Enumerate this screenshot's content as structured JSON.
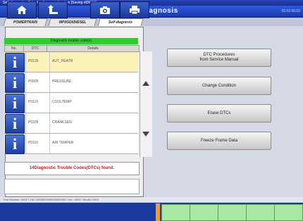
{
  "window": {
    "title": "Self-diagnosis - Select a diagnosis function [Saving diDEFC]"
  },
  "header": {
    "title": "Self-diagnosis",
    "version": "02.02.00.02"
  },
  "tabs": [
    {
      "label": "POWERTRAIN"
    },
    {
      "label": "MPI/GDI/DIESEL"
    },
    {
      "label": "Self-diagnosis"
    }
  ],
  "dtc_list": {
    "header": "Diagnostic trouble code(s)",
    "columns": [
      "No.",
      "DTC",
      "Details"
    ],
    "rows": [
      {
        "code": "P0135",
        "term": "AUT_HEATR"
      },
      {
        "code": "P0505",
        "term": "PRESSURE"
      },
      {
        "code": "P0115",
        "term": "COOLTEMP"
      },
      {
        "code": "P0335",
        "term": "CRANKSEN"
      },
      {
        "code": "P0110",
        "term": "AIR TEMPER"
      }
    ],
    "status": "14Diagnostic Trouble Codes(DTCs) found."
  },
  "actions": [
    {
      "label": "DTC Procedures\nfrom Service Manual"
    },
    {
      "label": "Change Condition"
    },
    {
      "label": "Erase DTCs"
    },
    {
      "label": "Freeze Frame Data"
    }
  ],
  "footer": {
    "text": "Part Number: 0000 / VIN: 0000000000000000000 / Ver.: 0000 / Model: 0000"
  },
  "toolbar": {
    "buttons": [
      {
        "icon": "home-icon"
      },
      {
        "icon": "back-icon"
      },
      {
        "icon": "camera-icon"
      },
      {
        "icon": "print-icon"
      }
    ]
  },
  "colors": {
    "accent": "#2ecc2e",
    "status_text": "#e01010",
    "header": "#2e58e0"
  }
}
